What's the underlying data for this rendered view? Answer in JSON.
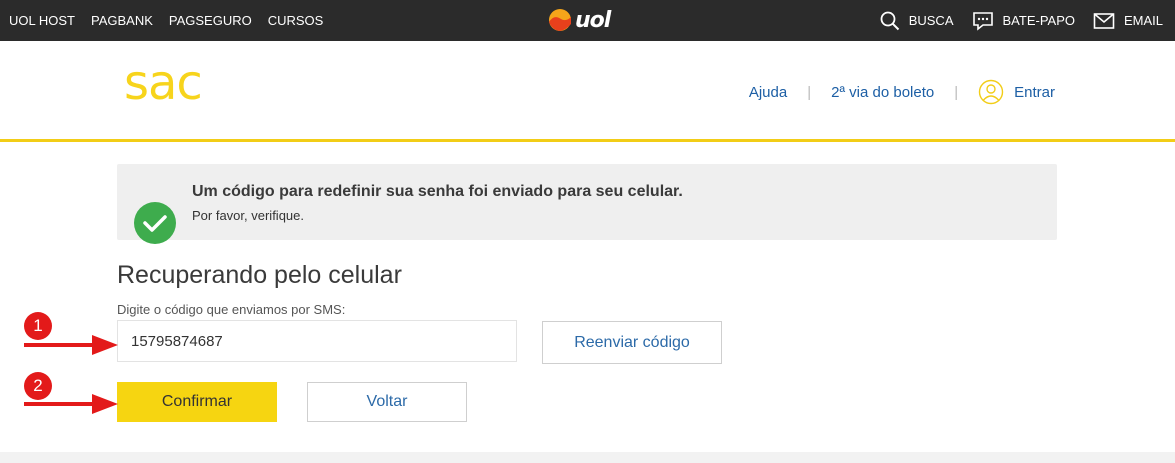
{
  "topbar": {
    "left_links": [
      "UOL HOST",
      "PAGBANK",
      "PAGSEGURO",
      "CURSOS"
    ],
    "logo_text": "uol",
    "right_links": {
      "search": "BUSCA",
      "chat": "BATE-PAPO",
      "email": "EMAIL"
    }
  },
  "header": {
    "brand": "sac",
    "nav": {
      "help": "Ajuda",
      "boleto": "2ª via do boleto",
      "login": "Entrar"
    }
  },
  "notice": {
    "title": "Um código para redefinir sua senha foi enviado para seu celular.",
    "subtitle": "Por favor, verifique."
  },
  "form": {
    "title": "Recuperando pelo celular",
    "code_label": "Digite o código que enviamos por SMS:",
    "code_value": "15795874687",
    "resend_label": "Reenviar código",
    "confirm_label": "Confirmar",
    "back_label": "Voltar"
  },
  "annotations": {
    "badge_1": "1",
    "badge_2": "2"
  },
  "colors": {
    "topbar_bg": "#2b2b2b",
    "brand_yellow": "#f7d41c",
    "link_blue": "#1d5fa5",
    "success_green": "#3eac4d",
    "annotation_red": "#e31a1a"
  }
}
